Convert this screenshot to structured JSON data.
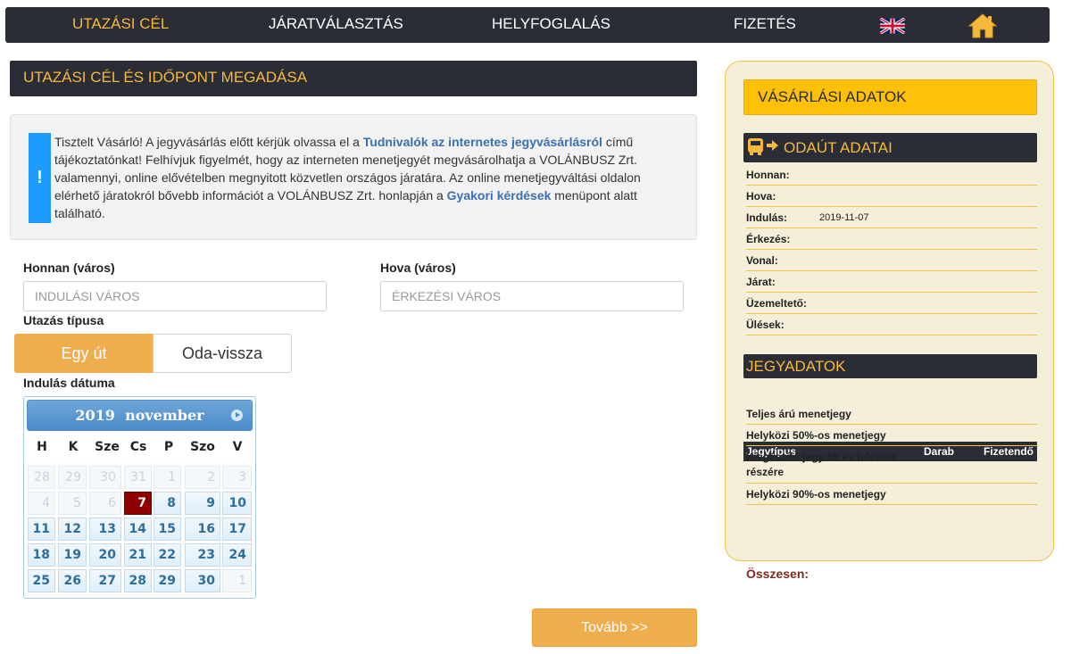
{
  "nav": {
    "items": [
      "UTAZÁSI CÉL",
      "JÁRATVÁLASZTÁS",
      "HELYFOGLALÁS",
      "FIZETÉS"
    ],
    "active_index": 0,
    "flag_icon": "uk-flag-icon",
    "home_icon": "home-icon",
    "active_color": "#f6b93b"
  },
  "section": {
    "title": "UTAZÁSI CÉL ÉS IDŐPONT MEGADÁSA"
  },
  "notice": {
    "marker": "!",
    "t1": "Tisztelt Vásárló! A jegyvásárlás előtt kérjük olvassa el a ",
    "link1": "Tudnivalók az internetes jegyvásárlásról",
    "t2": " című tájékoztatónkat! Felhívjuk figyelmét, hogy az interneten menetjegyét megvásárolhatja a VOLÁNBUSZ Zrt. valamennyi, online elővételben megnyitott közvetlen országos járatára. Az online menetjegyváltási oldalon elérhető járatokról bővebb információt a VOLÁNBUSZ Zrt. honlapján a ",
    "link2": "Gyakori kérdések",
    "t3": " menüpont alatt található."
  },
  "form": {
    "from_label": "Honnan (város)",
    "from_placeholder": "INDULÁSI VÁROS",
    "to_label": "Hova (város)",
    "to_placeholder": "ÉRKEZÉSI VÁROS",
    "trip_type_label": "Utazás típusa",
    "oneway": "Egy út",
    "roundtrip": "Oda-vissza",
    "date_label": "Indulás dátuma",
    "next_button": "Tovább >>"
  },
  "calendar": {
    "title": "2019  november",
    "weekdays": [
      "H",
      "K",
      "Sze",
      "Cs",
      "P",
      "Szo",
      "V"
    ],
    "weeks": [
      [
        {
          "d": "28",
          "o": true
        },
        {
          "d": "29",
          "o": true
        },
        {
          "d": "30",
          "o": true
        },
        {
          "d": "31",
          "o": true
        },
        {
          "d": "1",
          "o": true
        },
        {
          "d": "2",
          "o": true
        },
        {
          "d": "3",
          "o": true
        }
      ],
      [
        {
          "d": "4",
          "o": true
        },
        {
          "d": "5",
          "o": true
        },
        {
          "d": "6",
          "o": true
        },
        {
          "d": "7",
          "s": true
        },
        {
          "d": "8"
        },
        {
          "d": "9"
        },
        {
          "d": "10"
        }
      ],
      [
        {
          "d": "11"
        },
        {
          "d": "12"
        },
        {
          "d": "13"
        },
        {
          "d": "14"
        },
        {
          "d": "15"
        },
        {
          "d": "16"
        },
        {
          "d": "17"
        }
      ],
      [
        {
          "d": "18"
        },
        {
          "d": "19"
        },
        {
          "d": "20"
        },
        {
          "d": "21"
        },
        {
          "d": "22"
        },
        {
          "d": "23"
        },
        {
          "d": "24"
        }
      ],
      [
        {
          "d": "25"
        },
        {
          "d": "26"
        },
        {
          "d": "27"
        },
        {
          "d": "28"
        },
        {
          "d": "29"
        },
        {
          "d": "30"
        },
        {
          "d": "1",
          "o": true
        }
      ]
    ],
    "selected_color": "#8e0000"
  },
  "panel": {
    "title": "VÁSÁRLÁSI ADATOK",
    "trip_title": "ODAÚT ADATAI",
    "trip_icon": "bus-arrow-icon",
    "trip_rows": [
      {
        "label": "Honnan:",
        "value": ""
      },
      {
        "label": "Hova:",
        "value": ""
      },
      {
        "label": "Indulás:",
        "value": "2019-11-07"
      },
      {
        "label": "Érkezés:",
        "value": ""
      },
      {
        "label": "Vonal:",
        "value": ""
      },
      {
        "label": "Járat:",
        "value": ""
      },
      {
        "label": "Üzemeltető:",
        "value": ""
      },
      {
        "label": "Ülések:",
        "value": ""
      }
    ],
    "ticket_title": "JEGYADATOK",
    "ticket_headers": [
      "Jegytípus",
      "Darab",
      "Fizetendő"
    ],
    "ticket_rows": [
      "Teljes árú menetjegy",
      "Helyközi 50%-os menetjegy",
      "Kiegészítő jegy 65 év felettiek részére",
      "Helyközi 90%-os menetjegy"
    ],
    "total_label": "Összesen:"
  }
}
